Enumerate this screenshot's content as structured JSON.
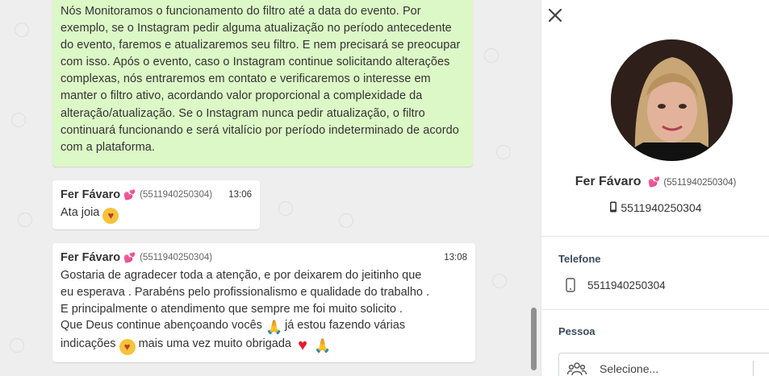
{
  "chat": {
    "outgoing": {
      "text": "Nós Monitoramos o funcionamento do filtro até a data do evento. Por exemplo, se o Instagram pedir alguma atualização no período antecedente do evento, faremos e atualizaremos seu filtro. E nem precisará se preocupar com isso. Após o evento, caso o Instagram continue solicitando alterações complexas, nós entraremos em contato e verificaremos o interesse em manter o filtro ativo, acordando valor proporcional a complexidade da alteração/atualização. Se o Instagram nunca pedir atualização, o filtro continuará funcionando e será vitalício por período indeterminado de acordo com a plataforma."
    },
    "messages": [
      {
        "sender": "Fer Fávaro",
        "phone": "(5511940250304)",
        "time": "13:06",
        "text": "Ata joia"
      },
      {
        "sender": "Fer Fávaro",
        "phone": "(5511940250304)",
        "time": "13:08",
        "line1": "Gostaria de agradecer toda a atenção, e por deixarem do jeitinho que",
        "line2": "eu esperava . Parabéns pelo profissionalismo e qualidade do trabalho .",
        "line3": "E principalmente o atendimento que sempre me foi muito solicito .",
        "line4a": "Que Deus continue abençoando vocês",
        "line4b": "já estou fazendo várias",
        "line5a": "indicações",
        "line5b": "mais uma vez muito obrigada"
      }
    ]
  },
  "contact": {
    "name": "Fer Fávaro",
    "phone_paren": "(5511940250304)",
    "phone": "5511940250304",
    "telefone_label": "Telefone",
    "telefone_value": "5511940250304",
    "pessoa_label": "Pessoa",
    "select_placeholder": "Selecione..."
  },
  "icons": {
    "heart_emoji": "💕",
    "smiling_face_with_hearts": "smiling-face-with-hearts",
    "folded_hands": "🙏",
    "red_heart": "♥"
  },
  "colors": {
    "outgoing_bubble": "#dcf8c6",
    "chat_bg": "#eeeeee"
  }
}
